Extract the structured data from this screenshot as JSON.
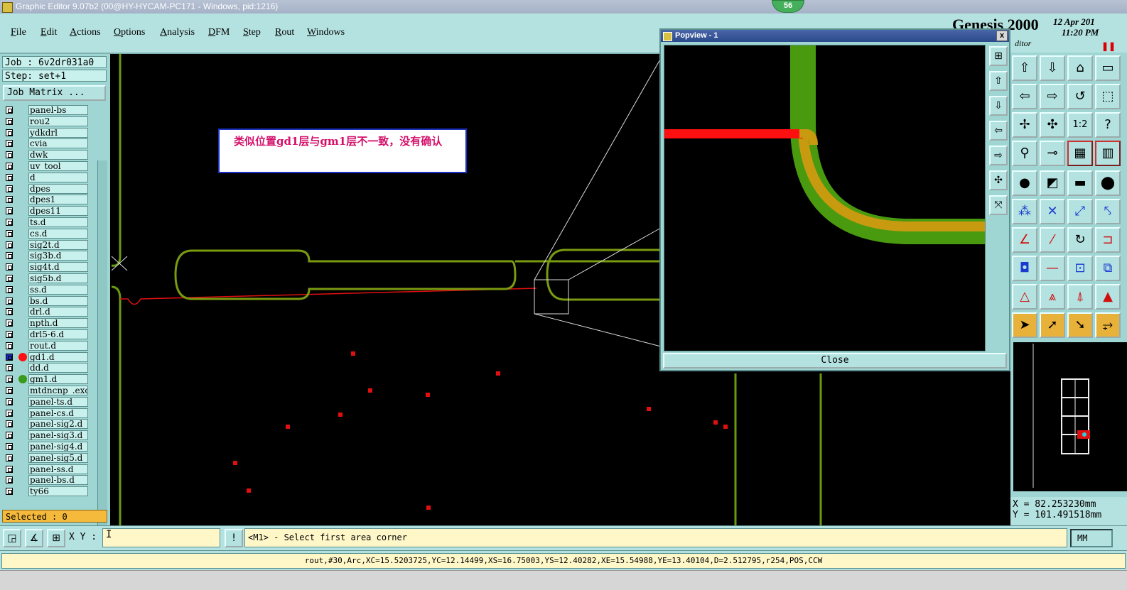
{
  "window": {
    "title": "Graphic Editor 9.07b2 (00@HY-HYCAM-PC171 - Windows, pid:1216)",
    "badge": "56"
  },
  "menu": [
    "File",
    "Edit",
    "Actions",
    "Options",
    "Analysis",
    "DFM",
    "Step",
    "Rout",
    "Windows"
  ],
  "genesis": {
    "logo": "Genesis 2000",
    "date": "12 Apr 201",
    "time": "11:20 PM",
    "subtitle": "ditor"
  },
  "job": {
    "job_label": "Job : 6v2dr031a0",
    "step_label": "Step: set+1",
    "matrix_button": "Job Matrix ..."
  },
  "layers": [
    {
      "name": "panel-bs"
    },
    {
      "name": "rou2"
    },
    {
      "name": "ydkdrl"
    },
    {
      "name": "cvia"
    },
    {
      "name": "dwk"
    },
    {
      "name": "uv_tool"
    },
    {
      "name": "d"
    },
    {
      "name": "dpes"
    },
    {
      "name": "dpes1"
    },
    {
      "name": "dpes11"
    },
    {
      "name": "ts.d"
    },
    {
      "name": "cs.d"
    },
    {
      "name": "sig2t.d"
    },
    {
      "name": "sig3b.d"
    },
    {
      "name": "sig4t.d"
    },
    {
      "name": "sig5b.d"
    },
    {
      "name": "ss.d"
    },
    {
      "name": "bs.d"
    },
    {
      "name": "drl.d"
    },
    {
      "name": "npth.d"
    },
    {
      "name": "drl5-6.d"
    },
    {
      "name": "rout.d"
    },
    {
      "name": "gd1.d",
      "color": "#ff1010",
      "work": true
    },
    {
      "name": "dd.d"
    },
    {
      "name": "gm1.d",
      "color": "#3a9a1a"
    },
    {
      "name": "mtdncnp_.exc"
    },
    {
      "name": "panel-ts.d"
    },
    {
      "name": "panel-cs.d"
    },
    {
      "name": "panel-sig2.d"
    },
    {
      "name": "panel-sig3.d"
    },
    {
      "name": "panel-sig4.d"
    },
    {
      "name": "panel-sig5.d"
    },
    {
      "name": "panel-ss.d"
    },
    {
      "name": "panel-bs.d"
    },
    {
      "name": "ty66"
    }
  ],
  "selected": "Selected : 0",
  "annotation": "类似位置gd1层与gm1层不一致，没有确认",
  "popview": {
    "title": "Popview - 1",
    "close_x": "x",
    "close_button": "Close"
  },
  "cursor": {
    "x": "X = 82.253230mm",
    "y": "Y = 101.491518mm"
  },
  "command": {
    "xy_label": "X Y :",
    "xy_value": "I",
    "prompt": "<M1> - Select first area corner",
    "units": "MM"
  },
  "status": "rout,#30,Arc,XC=15.5203725,YC=12.14499,XS=16.75003,YS=12.40282,XE=15.54988,YE=13.40104,D=2.512795,r254,POS,CCW",
  "colors": {
    "panel": "#9fd6d3",
    "gm1": "#4a9a10",
    "gd1": "#ff1010",
    "overlap": "#c89a10"
  }
}
